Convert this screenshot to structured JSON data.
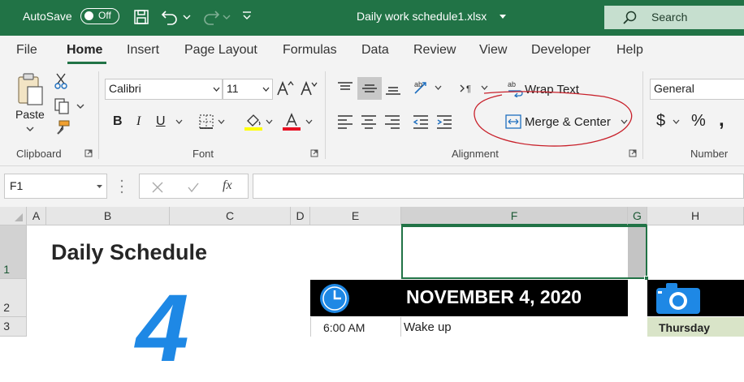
{
  "titlebar": {
    "autosave_label": "AutoSave",
    "autosave_state": "Off",
    "filename": "Daily work schedule1.xlsx",
    "search_label": "Search"
  },
  "menu": {
    "tabs": [
      "File",
      "Home",
      "Insert",
      "Page Layout",
      "Formulas",
      "Data",
      "Review",
      "View",
      "Developer",
      "Help"
    ]
  },
  "ribbon": {
    "clipboard": {
      "paste_label": "Paste",
      "group_label": "Clipboard"
    },
    "font": {
      "font_name": "Calibri",
      "font_size": "11",
      "group_label": "Font",
      "highlight_color": "#ffff00",
      "font_color": "#e81123"
    },
    "alignment": {
      "wrap_text_label": "Wrap Text",
      "merge_center_label": "Merge & Center",
      "group_label": "Alignment"
    },
    "number": {
      "format_value": "General",
      "group_label": "Number"
    }
  },
  "formula_bar": {
    "name_box": "F1",
    "fx_label": "fx",
    "formula_value": ""
  },
  "sheet": {
    "columns": [
      "A",
      "B",
      "C",
      "D",
      "E",
      "F",
      "G",
      "H"
    ],
    "rows": [
      "1",
      "2",
      "3"
    ],
    "title": "Daily Schedule",
    "big_number": "4",
    "date_header": "NOVEMBER 4, 2020",
    "time": "6:00 AM",
    "activity": "Wake up",
    "day": "Thursday"
  },
  "colors": {
    "excel_green": "#217346",
    "header_fill": "#000000",
    "accent_blue": "#1e88e5"
  }
}
